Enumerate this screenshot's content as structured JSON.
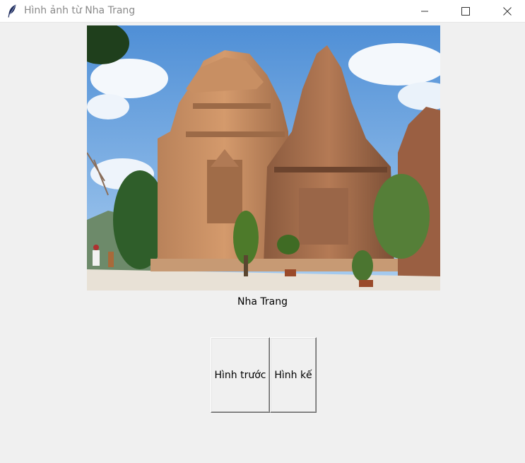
{
  "window": {
    "title": "Hình ảnh từ Nha Trang",
    "app_icon": "feather-icon",
    "controls": [
      "minimize-icon",
      "maximize-icon",
      "close-icon"
    ]
  },
  "photo": {
    "subject": "Po Nagar Cham towers, Nha Trang"
  },
  "caption": "Nha Trang",
  "buttons": {
    "previous_label": "Hình trước",
    "next_label": "Hình kế"
  },
  "colors": {
    "window_background": "#f0f0f0",
    "titlebar_background": "#ffffff",
    "title_text": "#8a8a8a"
  }
}
